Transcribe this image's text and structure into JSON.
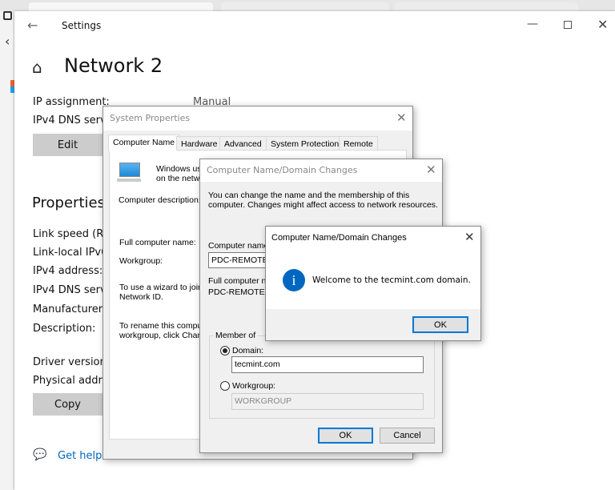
{
  "settings": {
    "window_title": "Settings",
    "page_title": "Network 2",
    "ip_assignment_label": "IP assignment:",
    "ip_assignment_value": "Manual",
    "ipv4_dns_label": "IPv4 DNS serve",
    "edit_button": "Edit",
    "properties_heading": "Properties",
    "properties": [
      "Link speed (Re",
      "Link-local IPv6",
      "IPv4 address:",
      "IPv4 DNS serve",
      "Manufacturer:",
      "Description:",
      "Driver version:",
      "Physical addres"
    ],
    "copy_button": "Copy",
    "get_help": "Get help"
  },
  "system_properties": {
    "title": "System Properties",
    "tabs": [
      "Computer Name",
      "Hardware",
      "Advanced",
      "System Protection",
      "Remote"
    ],
    "intro_line1": "Windows us",
    "intro_line2": "on the netw",
    "computer_description_label": "Computer description:",
    "full_computer_name_label": "Full computer name:",
    "workgroup_label": "Workgroup:",
    "wizard_line1": "To use a wizard to join",
    "wizard_line2": "Network ID.",
    "rename_line1": "To rename this comput",
    "rename_line2": "workgroup, click Chan"
  },
  "domain_changes": {
    "title": "Computer Name/Domain Changes",
    "description_line1": "You can change the name and the membership of this",
    "description_line2": "computer. Changes might affect access to network resources.",
    "computer_name_label": "Computer name",
    "computer_name_value": "PDC-REMOTE",
    "full_computer_name_label": "Full computer na",
    "full_computer_name_value": "PDC-REMOTE",
    "member_of_label": "Member of",
    "domain_label": "Domain:",
    "domain_value": "tecmint.com",
    "workgroup_label": "Workgroup:",
    "workgroup_value": "WORKGROUP",
    "selected": "domain",
    "ok_button": "OK",
    "cancel_button": "Cancel"
  },
  "message_box": {
    "title": "Computer Name/Domain Changes",
    "message": "Welcome to the tecmint.com domain.",
    "ok_button": "OK",
    "icon": "info-icon",
    "icon_color": "#0067c0"
  }
}
